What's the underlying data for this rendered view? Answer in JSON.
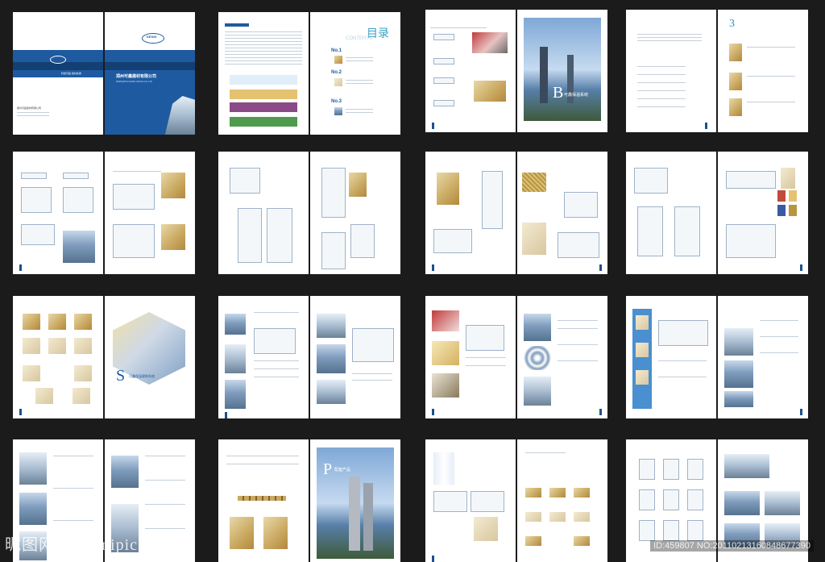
{
  "cover": {
    "logo_text": "KEXIN",
    "company_cn": "郑州可鑫建材有限公司",
    "company_en": "ZHENGZHOU KEXIN JIANCAI CO.,LTD",
    "back_company_cn": "郑州可鑫建材有限公司",
    "back_slogan": "科技可鑫·建材先锋"
  },
  "contents": {
    "title_cn": "目录",
    "title_en": "CONTENTS",
    "items": [
      "No.1",
      "No.2",
      "No.3"
    ]
  },
  "spread_b": {
    "letter": "B",
    "title": "可鑫保温系统"
  },
  "spread_3": {
    "number": "3"
  },
  "spread_s": {
    "letter": "S",
    "title": "可鑫保温建筑系统"
  },
  "spread_p": {
    "letter": "P",
    "title": "配套产品"
  },
  "watermark": {
    "site": "昵图网 www.nipic.com",
    "id": "ID:459807 NO:20110213160848677390"
  }
}
